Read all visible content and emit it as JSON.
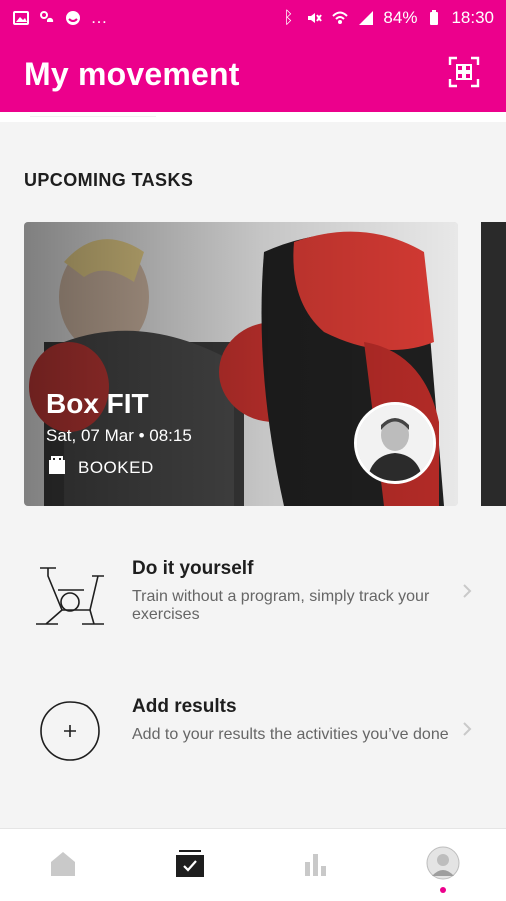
{
  "status_bar": {
    "time": "18:30",
    "battery": "84%",
    "left_icons": [
      "image-icon",
      "weather-icon",
      "smiley-icon",
      "more-dots-icon"
    ],
    "right_icons": [
      "bluetooth-icon",
      "mute-icon",
      "wifi-icon",
      "signal-icon",
      "battery-icon"
    ]
  },
  "header": {
    "title": "My movement",
    "qr_icon": "qr-scan-icon",
    "background": "#ec008c"
  },
  "upcoming": {
    "section_title": "UPCOMING TASKS",
    "card": {
      "title": "Box FIT",
      "date": "Sat, 07 Mar • 08:15",
      "status": "BOOKED"
    }
  },
  "actions": [
    {
      "title": "Do it yourself",
      "description": "Train without a program, simply track your exercises",
      "icon": "exercise-bike-icon"
    },
    {
      "title": "Add results",
      "description": "Add to your results the activities you’ve done",
      "icon": "add-circle-icon"
    }
  ],
  "bottom_nav": {
    "items": [
      {
        "name": "home",
        "icon": "home-icon",
        "active": false
      },
      {
        "name": "tasks",
        "icon": "checkbox-tray-icon",
        "active": true
      },
      {
        "name": "stats",
        "icon": "bar-chart-icon",
        "active": false
      },
      {
        "name": "profile",
        "icon": "avatar-icon",
        "active": false
      }
    ],
    "active_color": "#ec008c"
  }
}
